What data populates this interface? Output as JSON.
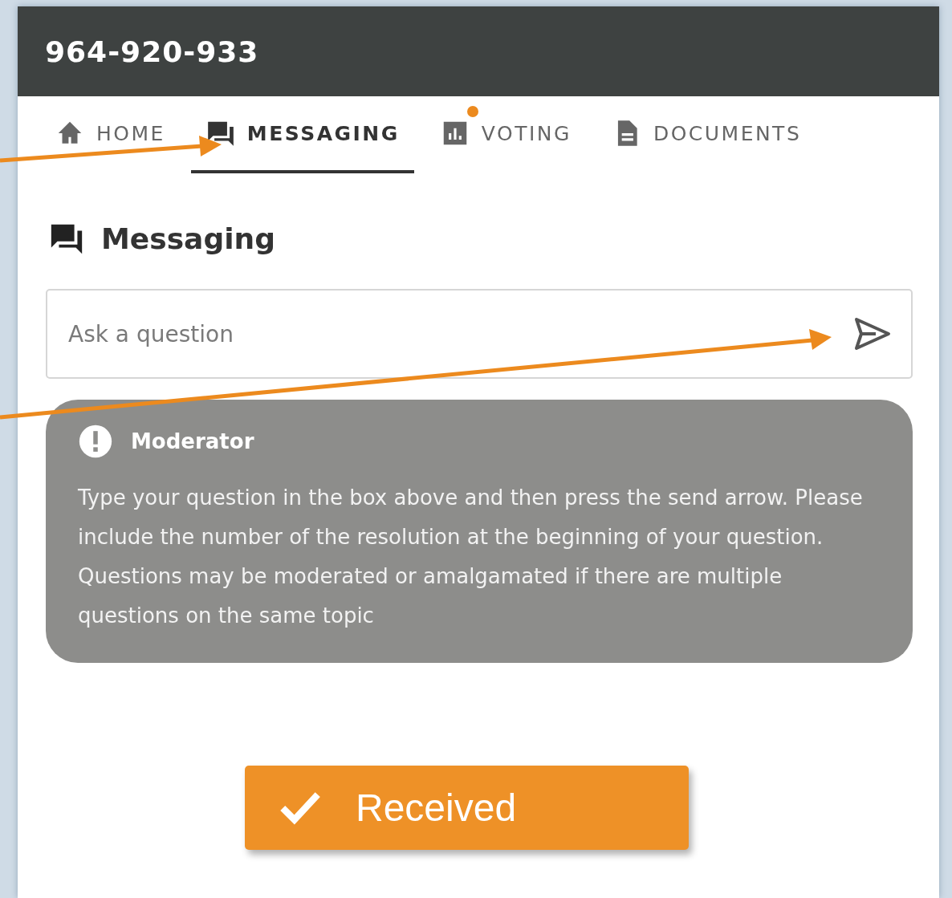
{
  "header": {
    "title": "964-920-933"
  },
  "tabs": [
    {
      "label": "HOME",
      "selected": false,
      "notification": false
    },
    {
      "label": "MESSAGING",
      "selected": true,
      "notification": false
    },
    {
      "label": "VOTING",
      "selected": false,
      "notification": true
    },
    {
      "label": "DOCUMENTS",
      "selected": false,
      "notification": false
    }
  ],
  "section": {
    "title": "Messaging"
  },
  "question_field": {
    "placeholder": "Ask a question"
  },
  "moderator_card": {
    "author": "Moderator",
    "message": "Type your question in the box above and then press the send arrow. Please include the number of the resolution at the beginning of your question. Questions may be moderated or amalgamated if there are multiple questions on the same topic"
  },
  "status_button": {
    "label": "Received"
  }
}
